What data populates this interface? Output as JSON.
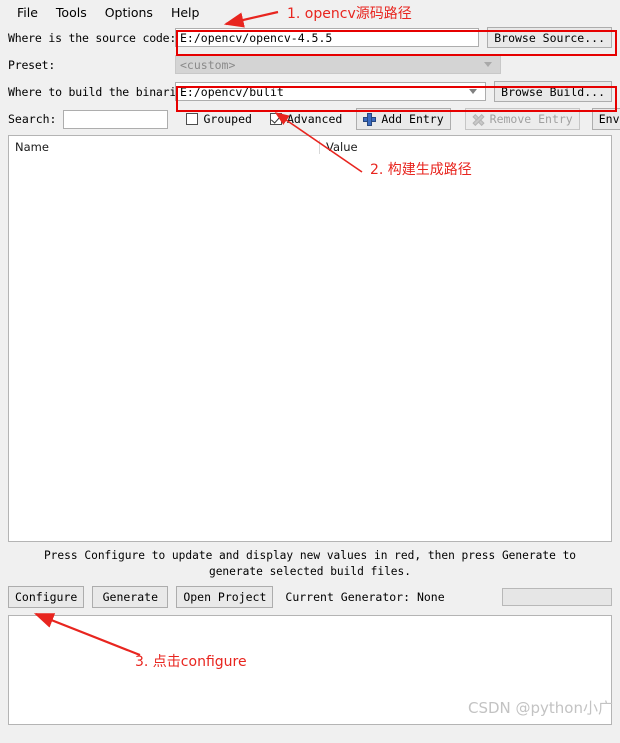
{
  "menubar": {
    "items": [
      {
        "label": "File"
      },
      {
        "label": "Tools"
      },
      {
        "label": "Options"
      },
      {
        "label": "Help"
      }
    ]
  },
  "form": {
    "source_label": "Where is the source code:",
    "source_value": "E:/opencv/opencv-4.5.5",
    "source_browse_label": "Browse Source...",
    "preset_label": "Preset:",
    "preset_value": "<custom>",
    "binaries_label": "Where to build the binaries:",
    "binaries_value": "E:/opencv/bulit",
    "binaries_browse_label": "Browse Build..."
  },
  "search": {
    "label": "Search:",
    "value": "",
    "placeholder": "",
    "grouped_label": "Grouped",
    "grouped_checked": false,
    "advanced_label": "Advanced",
    "advanced_checked": true,
    "add_entry_label": "Add Entry",
    "remove_entry_label": "Remove Entry",
    "environment_label": "Environment..."
  },
  "table": {
    "columns": [
      "Name",
      "Value"
    ],
    "rows": []
  },
  "status": {
    "message": "Press Configure to update and display new values in red, then press Generate to generate selected build files."
  },
  "actions": {
    "configure_label": "Configure",
    "generate_label": "Generate",
    "open_project_label": "Open Project",
    "current_generator_label": "Current Generator: None",
    "progress_value": ""
  },
  "output": {
    "text": "",
    "watermark": "CSDN @python小广"
  },
  "annotations": [
    {
      "id": 1,
      "text": "1. opencv源码路径"
    },
    {
      "id": 2,
      "text": "2. 构建生成路径"
    },
    {
      "id": 3,
      "text": "3. 点击configure"
    }
  ],
  "colors": {
    "annotation_red": "#e8251f",
    "box_red": "#e60000",
    "window_bg": "#f0f0f0",
    "field_bg": "#ffffff",
    "button_bg": "#e9e9e9",
    "disabled_text": "#a0a0a0",
    "watermark_gray": "#c3c3c3"
  }
}
